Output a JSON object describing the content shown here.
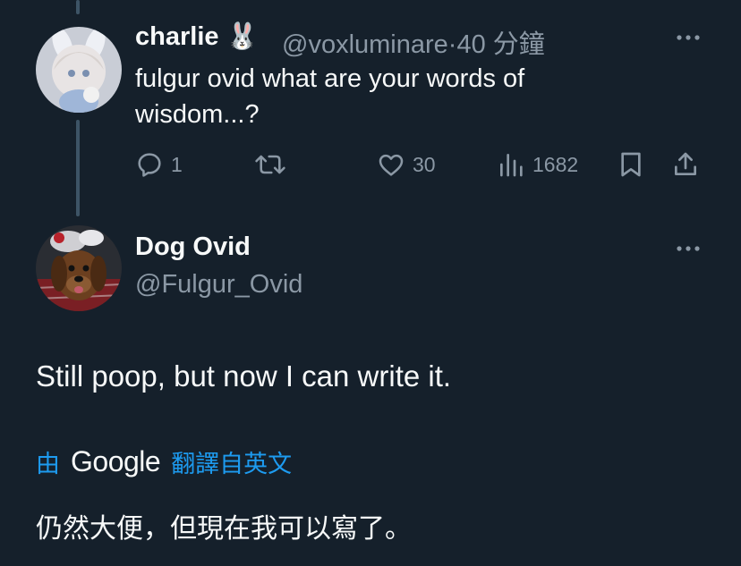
{
  "reply_tweet": {
    "display_name": "charlie",
    "name_emoji": "🐰",
    "handle": "@voxluminare",
    "separator": "·",
    "time": "40 分鐘",
    "text": "fulgur ovid what are your words of wisdom...?",
    "actions": {
      "replies": "1",
      "retweets": "",
      "likes": "30",
      "views": "1682"
    }
  },
  "main_tweet": {
    "display_name": "Dog Ovid",
    "handle": "@Fulgur_Ovid",
    "text": "Still poop, but now I can write it.",
    "translate": {
      "prefix": "由",
      "brand": "Google",
      "suffix": "翻譯自英文"
    },
    "translated_text": "仍然大便，但現在我可以寫了。"
  },
  "colors": {
    "background": "#15202b",
    "text": "#f7f9f9",
    "muted": "#8b98a5",
    "accent": "#1d9bf0",
    "thread_line": "#3d5466"
  },
  "icons": {
    "reply": "reply-icon",
    "retweet": "retweet-icon",
    "like": "heart-icon",
    "views": "views-icon",
    "bookmark": "bookmark-icon",
    "share": "share-icon",
    "more": "more-icon"
  }
}
